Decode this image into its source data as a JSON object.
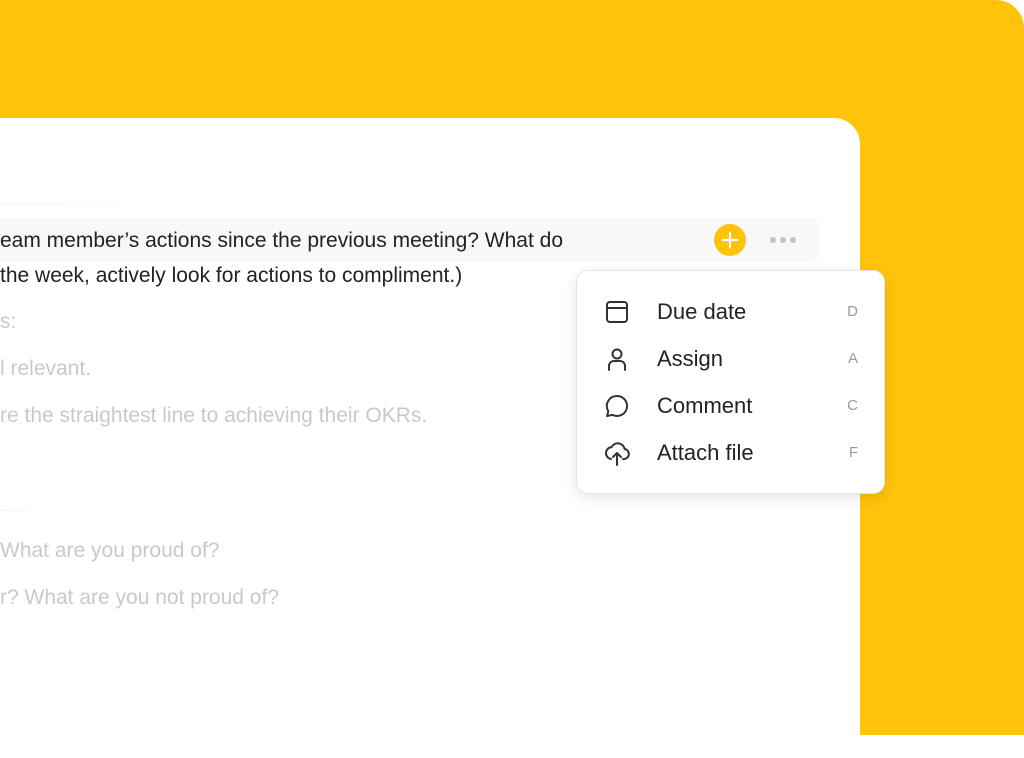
{
  "document": {
    "lines": [
      "eam member’s actions since the previous meeting? What do",
      " the week, actively look for actions to compliment.)",
      "s:",
      "l relevant.",
      "re the straightest line to achieving their OKRs.",
      "What are you proud of?",
      "r? What are you not proud of?"
    ]
  },
  "block_actions": {
    "add_icon": "plus-icon",
    "more_icon": "ellipsis-icon"
  },
  "menu": {
    "items": [
      {
        "label": "Due date",
        "shortcut": "D",
        "icon": "calendar-icon"
      },
      {
        "label": "Assign",
        "shortcut": "A",
        "icon": "person-icon"
      },
      {
        "label": "Comment",
        "shortcut": "C",
        "icon": "comment-icon"
      },
      {
        "label": "Attach file",
        "shortcut": "F",
        "icon": "upload-cloud-icon"
      }
    ]
  },
  "colors": {
    "accent": "#FFC30B",
    "text": "#222222",
    "muted_text": "#C9C9C9"
  }
}
